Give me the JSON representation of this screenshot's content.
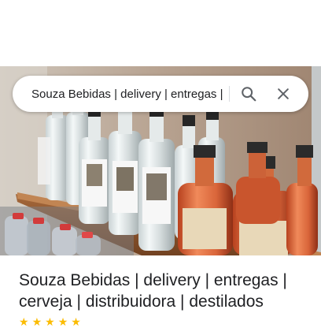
{
  "search": {
    "query": "Souza Bebidas | delivery | entregas | cerveja | distribuidora | destilados",
    "search_icon": "search-icon",
    "close_icon": "close-icon"
  },
  "photo": {
    "subject": "bottles of liquor on a wooden shelf"
  },
  "place": {
    "title": "Souza Bebidas | delivery | entregas | cerveja | distribuidora | destilados"
  },
  "colors": {
    "accent_star": "#fbbc04",
    "text_primary": "#202124",
    "icon_gray": "#5f6368"
  }
}
